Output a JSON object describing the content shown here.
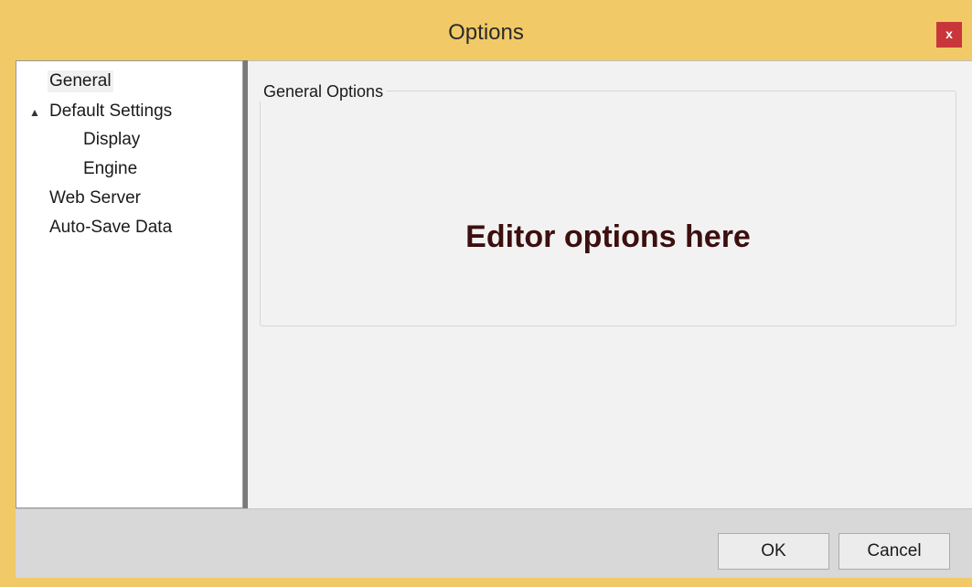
{
  "window": {
    "title": "Options",
    "close_label": "x"
  },
  "tree": {
    "items": [
      {
        "label": "General",
        "selected": true,
        "level": 0
      },
      {
        "label": "Default Settings",
        "expanded": true,
        "level": 0,
        "expander": "▲"
      },
      {
        "label": "Display",
        "level": 1
      },
      {
        "label": "Engine",
        "level": 1
      },
      {
        "label": "Web Server",
        "level": 0
      },
      {
        "label": "Auto-Save Data",
        "level": 0
      }
    ]
  },
  "content": {
    "group_title": "General Options",
    "placeholder": "Editor options here"
  },
  "footer": {
    "ok_label": "OK",
    "cancel_label": "Cancel"
  },
  "colors": {
    "window_frame": "#f1c967",
    "close_button": "#c8363b",
    "placeholder_text": "#3d0f0f"
  }
}
